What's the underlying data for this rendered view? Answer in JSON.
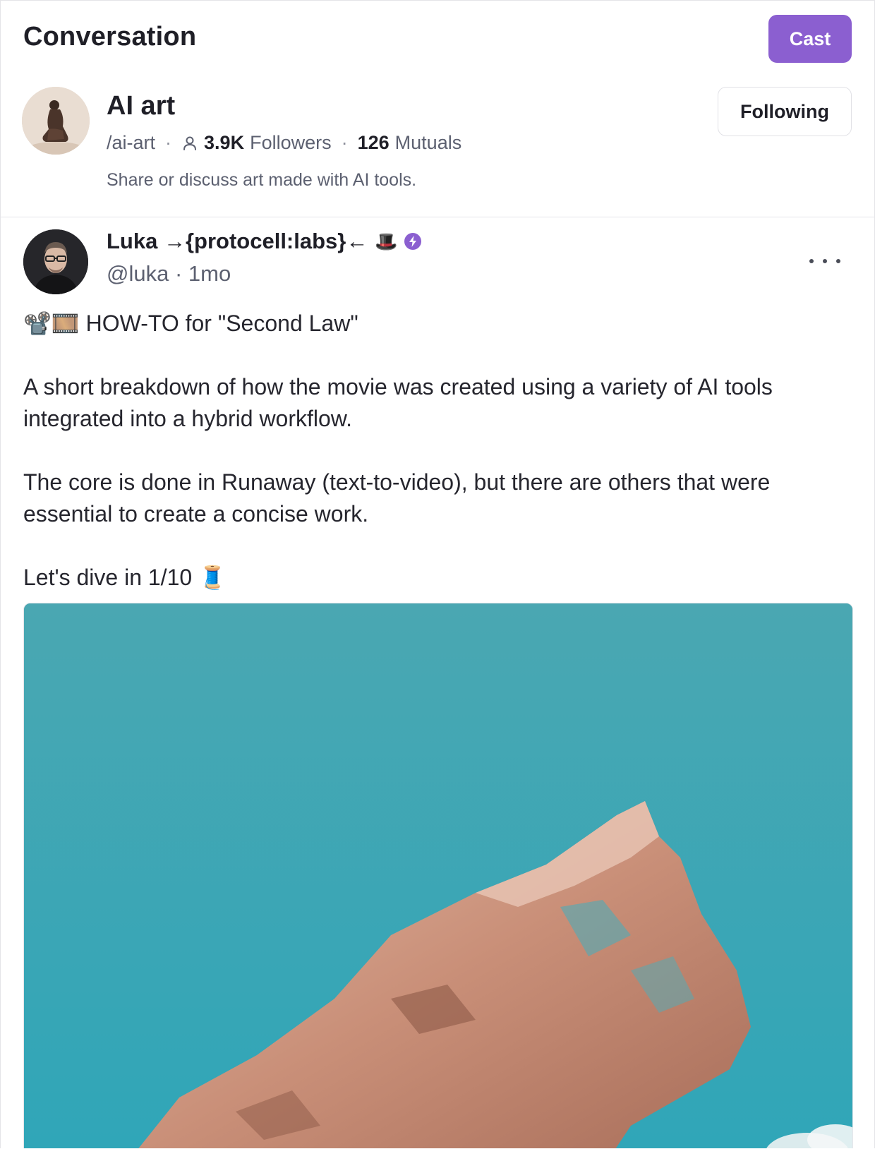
{
  "header": {
    "title": "Conversation",
    "cast_label": "Cast"
  },
  "channel": {
    "name": "AI art",
    "slug": "/ai-art",
    "followers_count": "3.9K",
    "followers_label": "Followers",
    "mutuals_count": "126",
    "mutuals_label": "Mutuals",
    "description": "Share or discuss art made with AI tools.",
    "follow_state_label": "Following",
    "separator": "·"
  },
  "post": {
    "author_name": "Luka →{protocell:labs}←",
    "author_emoji": "🎩",
    "handle": "@luka",
    "time_separator": "·",
    "age": "1mo",
    "paragraphs": [
      "📽️🎞️ HOW-TO for \"Second Law\"",
      "A short breakdown of how the movie was created using a variety of AI tools integrated into a hybrid workflow.",
      "The core is done in Runaway (text-to-video), but there are others that were essential to create a concise work.",
      "Let's dive in 1/10 🧵"
    ]
  },
  "colors": {
    "accent": "#8b5fd0",
    "verified": "#8b5fd0",
    "text_muted": "#5c6070",
    "sky": "#3fa9b3",
    "rock": "#c98f78"
  },
  "icons": {
    "followers": "user-icon",
    "verified": "power-badge-icon",
    "more": "more-horizontal-icon"
  }
}
